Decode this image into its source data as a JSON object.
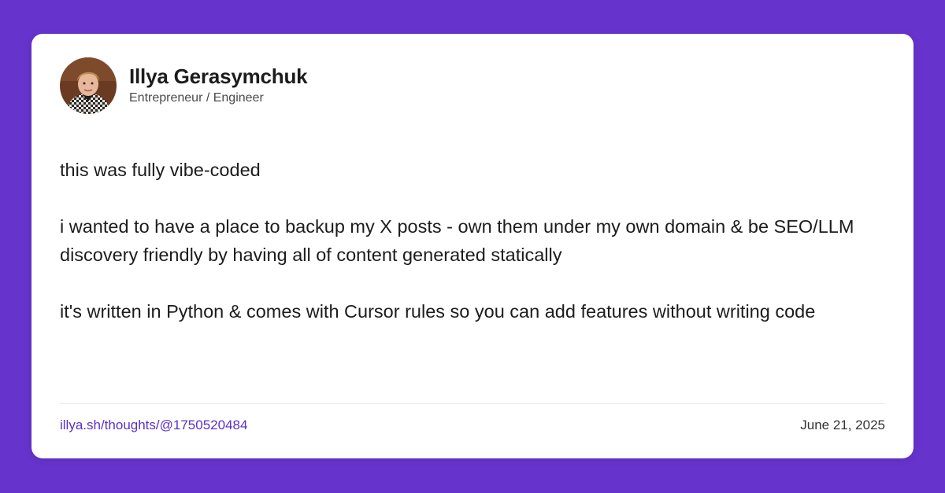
{
  "colors": {
    "background": "#6633cc",
    "card": "#ffffff",
    "link": "#5b2fc9",
    "text": "#1c1c1c"
  },
  "author": {
    "name": "Illya Gerasymchuk",
    "role": "Entrepreneur / Engineer",
    "avatar_icon": "profile-photo"
  },
  "post": {
    "paragraphs": [
      "this was fully vibe-coded",
      "i wanted to have a place to backup my X posts - own them under my own domain & be SEO/LLM discovery friendly by having all of content generated statically",
      "it's written in Python & comes with Cursor rules so you can add features without writing code"
    ]
  },
  "footer": {
    "link_text": "illya.sh/thoughts/@1750520484",
    "date": "June 21, 2025"
  }
}
